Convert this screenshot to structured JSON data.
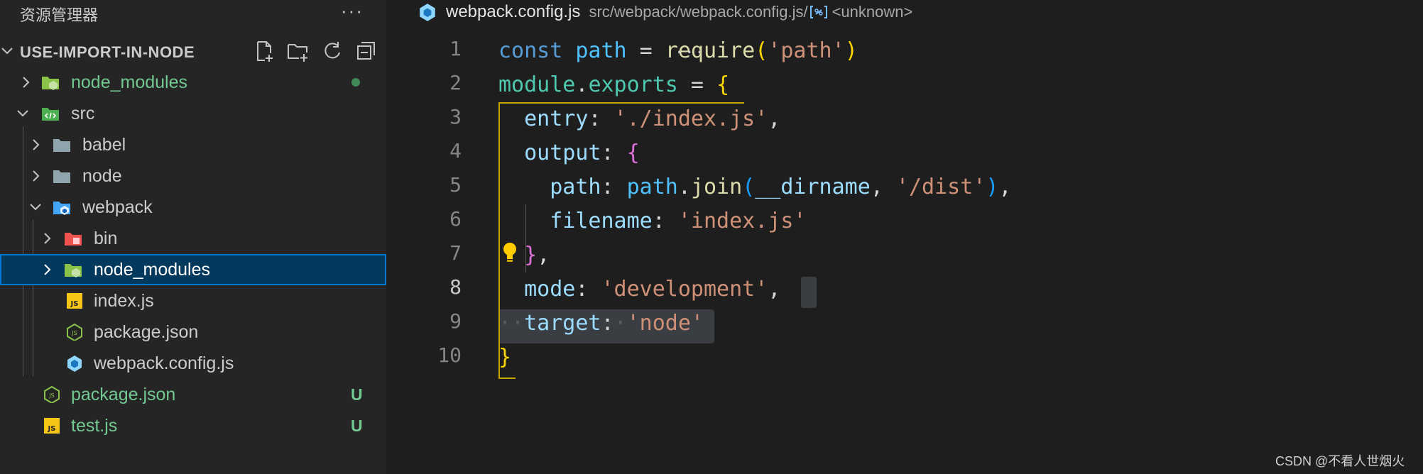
{
  "sidebar": {
    "title": "资源管理器",
    "more": "···",
    "project": "USE-IMPORT-IN-NODE",
    "actions": [
      "new-file-icon",
      "new-folder-icon",
      "refresh-icon",
      "collapse-all-icon"
    ],
    "items": [
      {
        "label": "node_modules",
        "icon": "node-modules-folder-icon",
        "status": "dot"
      },
      {
        "label": "src",
        "icon": "src-folder-icon"
      },
      {
        "label": "babel",
        "icon": "folder-icon"
      },
      {
        "label": "node",
        "icon": "folder-icon"
      },
      {
        "label": "webpack",
        "icon": "webpack-folder-icon"
      },
      {
        "label": "bin",
        "icon": "bin-folder-icon"
      },
      {
        "label": "node_modules",
        "icon": "node-modules-folder-icon"
      },
      {
        "label": "index.js",
        "icon": "js-file-icon"
      },
      {
        "label": "package.json",
        "icon": "nodejs-file-icon"
      },
      {
        "label": "webpack.config.js",
        "icon": "webpack-file-icon"
      },
      {
        "label": "package.json",
        "icon": "nodejs-file-icon",
        "badge": "U"
      },
      {
        "label": "test.js",
        "icon": "js-file-icon",
        "badge": "U"
      }
    ]
  },
  "editor": {
    "breadcrumb": {
      "file": "webpack.config.js",
      "path": "src/webpack/webpack.config.js/",
      "symbol": "<unknown>"
    },
    "line_numbers": [
      "1",
      "2",
      "3",
      "4",
      "5",
      "6",
      "7",
      "8",
      "9",
      "10"
    ],
    "active_line": "8",
    "code": {
      "l1": {
        "kw": "const",
        "var": "path",
        "eq": " = ",
        "fn": "require",
        "open": "(",
        "str": "'path'",
        "close": ")"
      },
      "l2": {
        "mod": "module",
        "dot": ".",
        "prop": "exports",
        "eq": " = ",
        "brace": "{"
      },
      "l3": {
        "prop": "entry",
        "colon": ": ",
        "str": "'./index.js'",
        "comma": ","
      },
      "l4": {
        "prop": "output",
        "colon": ": ",
        "brace": "{"
      },
      "l5": {
        "prop": "path",
        "colon": ": ",
        "var": "path",
        "dot": ".",
        "fn": "join",
        "open": "(",
        "arg": "__dirname",
        "sep": ", ",
        "str": "'/dist'",
        "close": ")",
        "comma": ","
      },
      "l6": {
        "prop": "filename",
        "colon": ": ",
        "str": "'index.js'"
      },
      "l7": {
        "brace": "}",
        "comma": ","
      },
      "l8": {
        "prop": "mode",
        "colon": ": ",
        "str": "'development'",
        "comma": ","
      },
      "l9": {
        "prop": "target",
        "colon": ":",
        "str": "'node'"
      },
      "l10": {
        "brace": "}"
      }
    }
  },
  "watermark": "CSDN @不看人世烟火"
}
